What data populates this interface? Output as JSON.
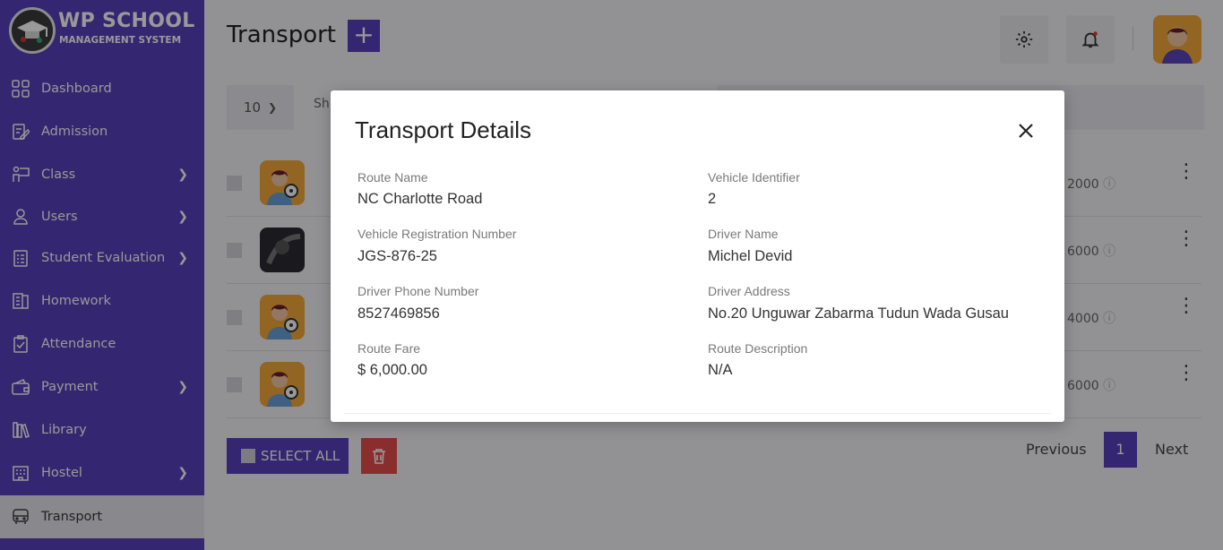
{
  "brand": {
    "title": "WP SCHOOL",
    "subtitle": "MANAGEMENT SYSTEM"
  },
  "sidebar": {
    "items": [
      {
        "label": "Dashboard",
        "icon": "dashboard-icon",
        "has_submenu": false
      },
      {
        "label": "Admission",
        "icon": "admission-icon",
        "has_submenu": false
      },
      {
        "label": "Class",
        "icon": "class-icon",
        "has_submenu": true
      },
      {
        "label": "Users",
        "icon": "user-icon",
        "has_submenu": true
      },
      {
        "label": "Student Evaluation",
        "icon": "evaluation-icon",
        "has_submenu": true
      },
      {
        "label": "Homework",
        "icon": "homework-icon",
        "has_submenu": false
      },
      {
        "label": "Attendance",
        "icon": "attendance-icon",
        "has_submenu": false
      },
      {
        "label": "Payment",
        "icon": "wallet-icon",
        "has_submenu": true
      },
      {
        "label": "Library",
        "icon": "library-icon",
        "has_submenu": false
      },
      {
        "label": "Hostel",
        "icon": "hostel-icon",
        "has_submenu": true
      },
      {
        "label": "Transport",
        "icon": "bus-icon",
        "has_submenu": false,
        "active": true
      }
    ]
  },
  "header": {
    "title": "Transport",
    "add_label": "+"
  },
  "list": {
    "page_size": "10",
    "show_label": "Sh",
    "rows": [
      {
        "fare": "2000",
        "avatar": "driver-avatar"
      },
      {
        "fare": "6000",
        "avatar": "photo-avatar"
      },
      {
        "fare": "4000",
        "avatar": "driver-avatar"
      },
      {
        "fare": "6000",
        "avatar": "driver-avatar"
      }
    ],
    "select_all_label": "SELECT ALL"
  },
  "pagination": {
    "previous": "Previous",
    "current": "1",
    "next": "Next"
  },
  "modal": {
    "title": "Transport Details",
    "fields": {
      "route_name": {
        "label": "Route Name",
        "value": "NC Charlotte Road"
      },
      "vehicle_identifier": {
        "label": "Vehicle Identifier",
        "value": "2"
      },
      "vehicle_registration": {
        "label": "Vehicle Registration Number",
        "value": "JGS-876-25"
      },
      "driver_name": {
        "label": "Driver Name",
        "value": "Michel Devid"
      },
      "driver_phone": {
        "label": "Driver Phone Number",
        "value": "8527469856"
      },
      "driver_address": {
        "label": "Driver Address",
        "value": "No.20 Unguwar Zabarma Tudun Wada Gusau"
      },
      "route_fare": {
        "label": "Route Fare",
        "value": "$ 6,000.00"
      },
      "route_description": {
        "label": "Route Description",
        "value": "N/A"
      }
    }
  },
  "colors": {
    "primary": "#5840bb",
    "danger": "#e74c4c",
    "avatar_bg": "#f4a93a"
  }
}
